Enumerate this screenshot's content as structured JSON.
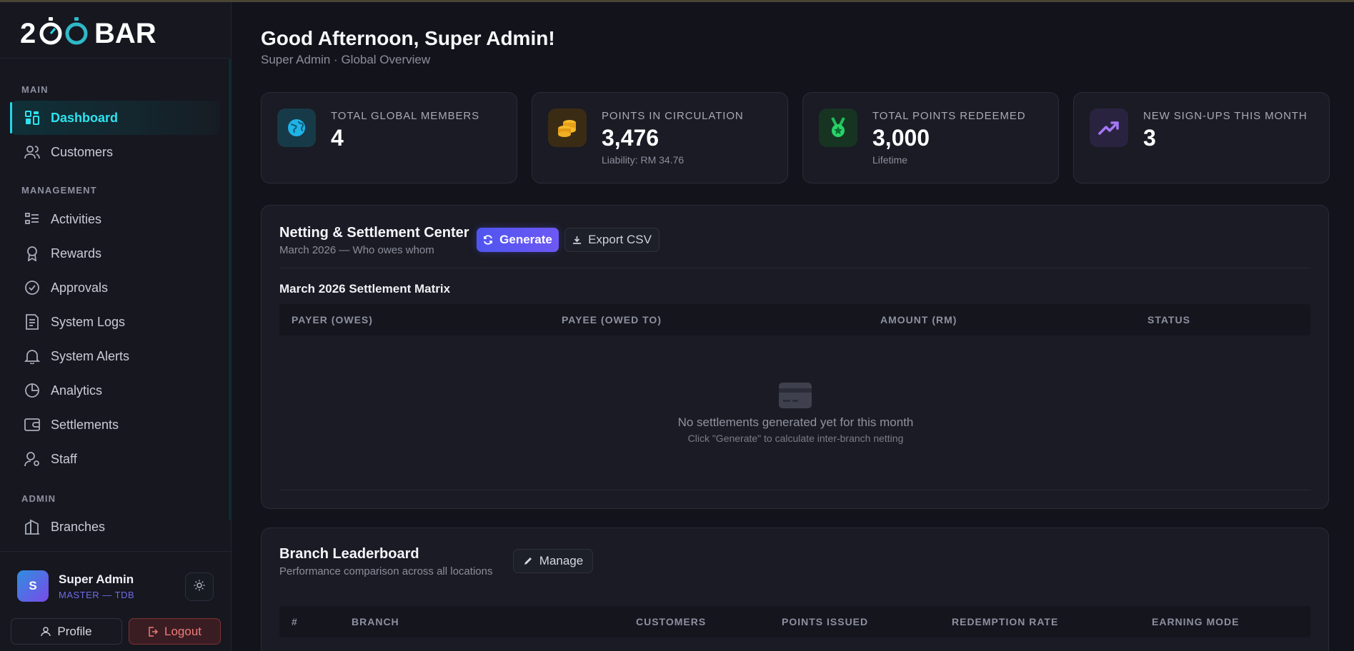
{
  "app": {
    "logo_text": "200 BAR"
  },
  "sidebar": {
    "sections": {
      "main": "MAIN",
      "management": "MANAGEMENT",
      "admin": "ADMIN"
    },
    "items": [
      {
        "label": "Dashboard",
        "icon": "dashboard-icon",
        "active": true
      },
      {
        "label": "Customers",
        "icon": "users-icon"
      },
      {
        "label": "Activities",
        "icon": "list-icon"
      },
      {
        "label": "Rewards",
        "icon": "award-icon"
      },
      {
        "label": "Approvals",
        "icon": "check-circle-icon"
      },
      {
        "label": "System Logs",
        "icon": "document-icon"
      },
      {
        "label": "System Alerts",
        "icon": "bell-icon"
      },
      {
        "label": "Analytics",
        "icon": "pie-chart-icon"
      },
      {
        "label": "Settlements",
        "icon": "wallet-icon"
      },
      {
        "label": "Staff",
        "icon": "user-cog-icon"
      },
      {
        "label": "Branches",
        "icon": "building-icon"
      }
    ],
    "user": {
      "initial": "S",
      "name": "Super Admin",
      "role": "MASTER — TDB"
    },
    "profile_label": "Profile",
    "logout_label": "Logout"
  },
  "header": {
    "greeting": "Good Afternoon, Super Admin!",
    "subtitle": "Super Admin · Global Overview"
  },
  "stats": [
    {
      "label": "TOTAL GLOBAL MEMBERS",
      "value": "4",
      "sub": "",
      "icon": "globe-icon",
      "color": "#22b8e6"
    },
    {
      "label": "POINTS IN CIRCULATION",
      "value": "3,476",
      "sub": "Liability: RM 34.76",
      "icon": "coins-icon",
      "color": "#f2a81d"
    },
    {
      "label": "TOTAL POINTS REDEEMED",
      "value": "3,000",
      "sub": "Lifetime",
      "icon": "medal-icon",
      "color": "#22d36a"
    },
    {
      "label": "NEW SIGN-UPS THIS MONTH",
      "value": "3",
      "sub": "",
      "icon": "trending-up-icon",
      "color": "#9b6cf0"
    }
  ],
  "settlement": {
    "title": "Netting & Settlement Center",
    "subtitle": "March 2026 — Who owes whom",
    "generate_label": "Generate",
    "export_label": "Export CSV",
    "matrix_title": "March 2026 Settlement Matrix",
    "columns": [
      "PAYER (OWES)",
      "PAYEE (OWED TO)",
      "AMOUNT (RM)",
      "STATUS"
    ],
    "empty_title": "No settlements generated yet for this month",
    "empty_sub": "Click \"Generate\" to calculate inter-branch netting"
  },
  "leaderboard": {
    "title": "Branch Leaderboard",
    "subtitle": "Performance comparison across all locations",
    "manage_label": "Manage",
    "columns": [
      "#",
      "BRANCH",
      "CUSTOMERS",
      "POINTS ISSUED",
      "REDEMPTION RATE",
      "EARNING MODE"
    ]
  }
}
